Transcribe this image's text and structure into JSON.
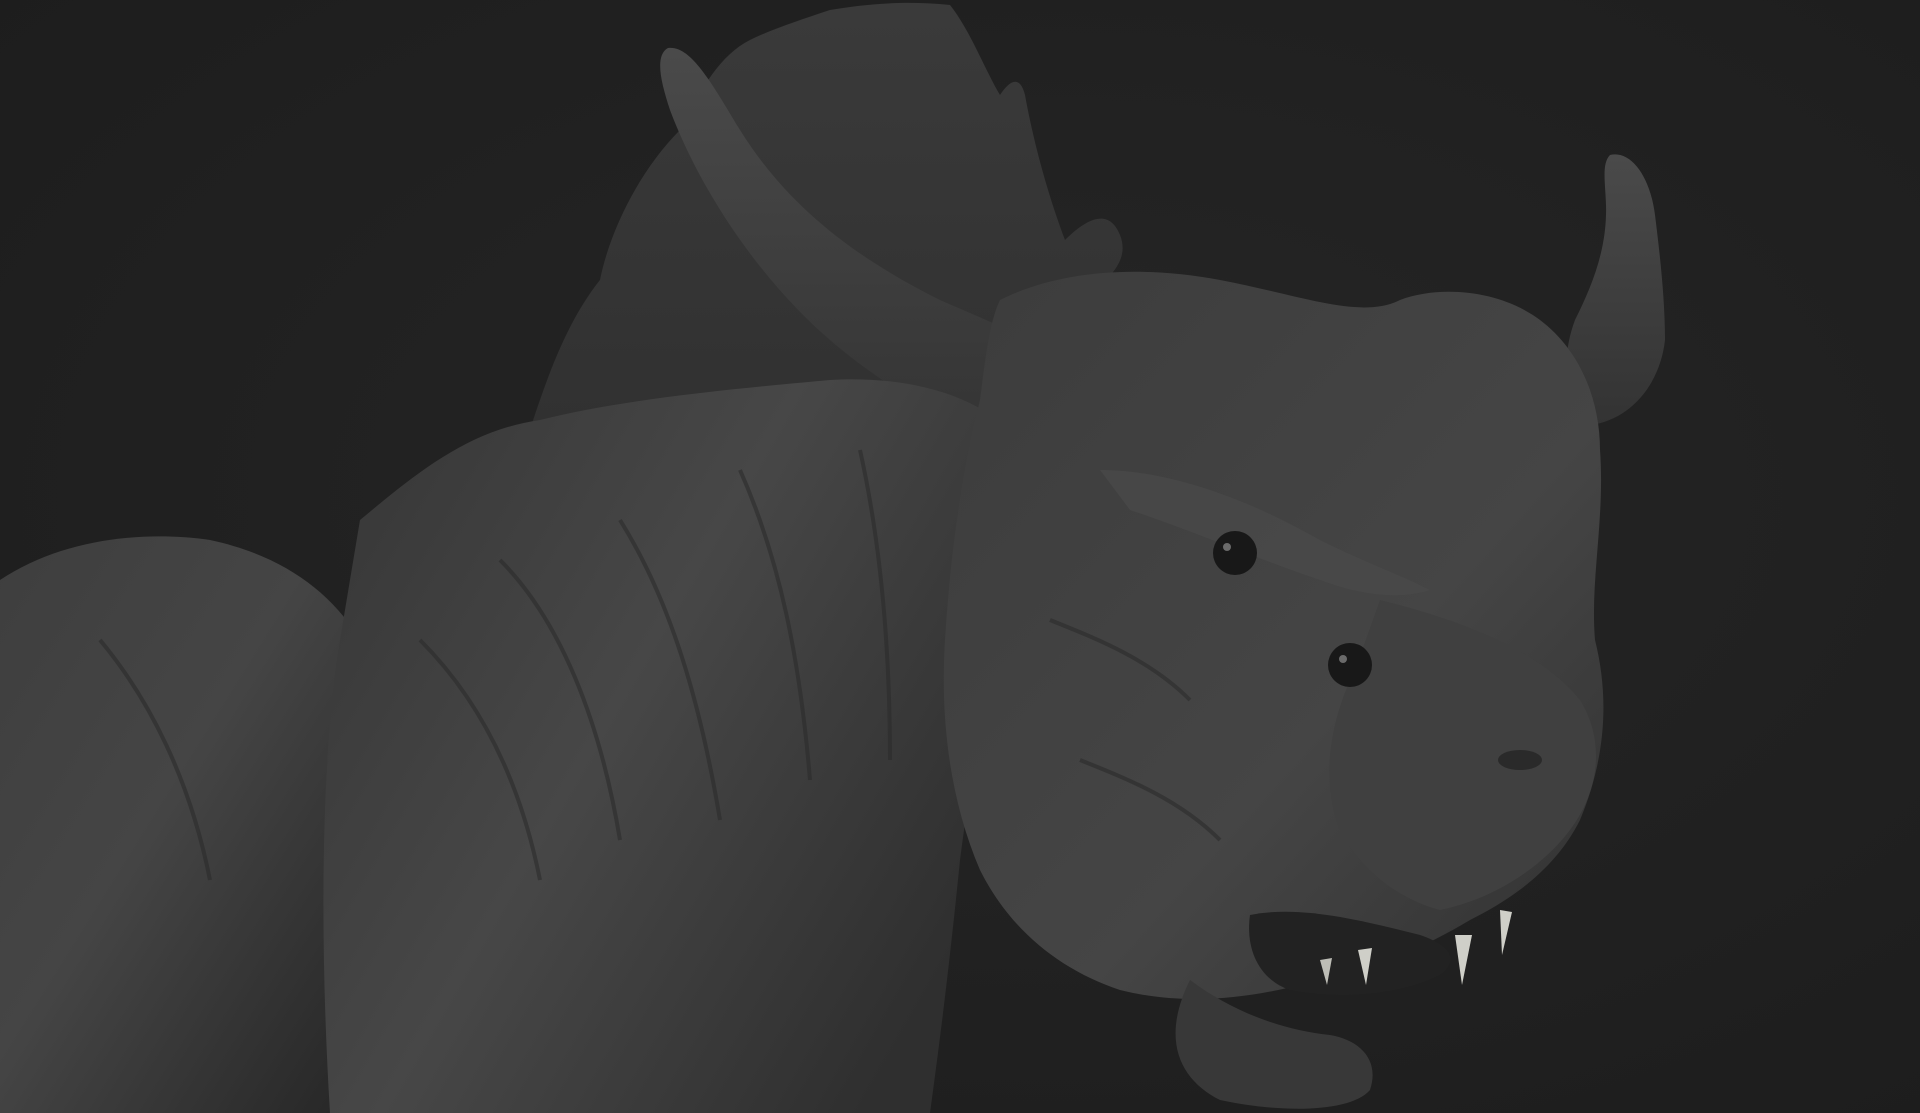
{
  "scene": {
    "subject": "sculpt-render",
    "colors": {
      "background": "#1f1f1f",
      "clay_dark": "#2b2b2b",
      "clay_mid": "#3a3a3a",
      "clay_light": "#4e4e4e",
      "eye": "#141414",
      "tooth": "#cfcfc8"
    }
  }
}
